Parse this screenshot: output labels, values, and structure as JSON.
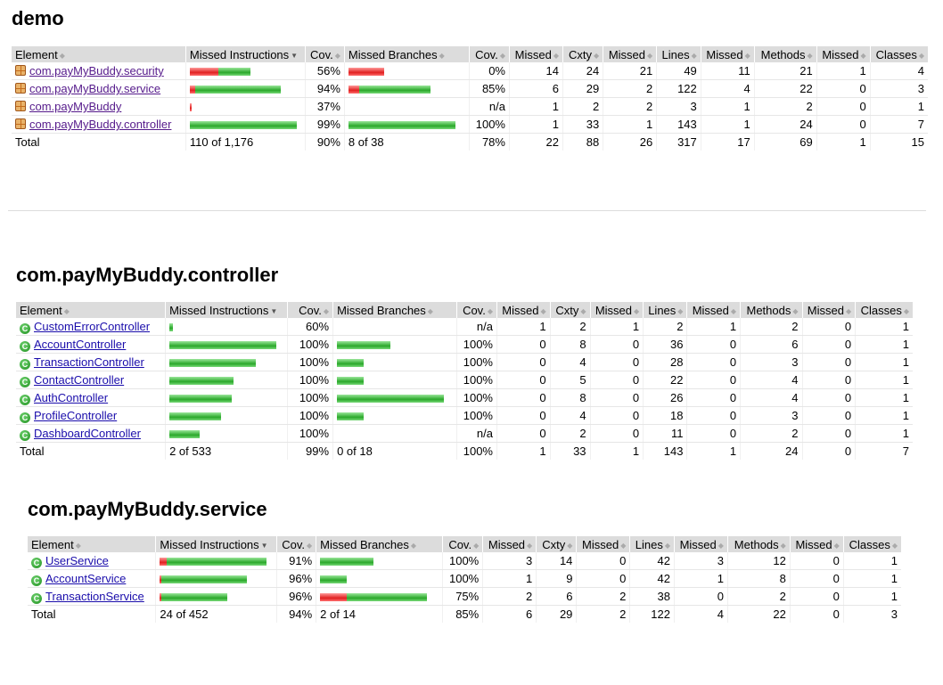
{
  "headers": {
    "element": "Element",
    "missed_instructions": "Missed Instructions",
    "cov": "Cov.",
    "missed_branches": "Missed Branches",
    "missed": "Missed",
    "cxty": "Cxty",
    "lines": "Lines",
    "methods": "Methods",
    "classes": "Classes",
    "total": "Total"
  },
  "sections": [
    {
      "title": "demo",
      "element_kind": "package",
      "rows": [
        {
          "name": "com.payMyBuddy.security",
          "instr": {
            "missed": 0.27,
            "covered": 0.3
          },
          "instr_cov": "56%",
          "br": {
            "missed": 0.33,
            "covered": 0.0
          },
          "br_cov": "0%",
          "mc": "14",
          "cx": "24",
          "ml": "21",
          "li": "49",
          "mm": "11",
          "me": "21",
          "mcl": "1",
          "cl": "4"
        },
        {
          "name": "com.payMyBuddy.service",
          "instr": {
            "missed": 0.05,
            "covered": 0.8
          },
          "instr_cov": "94%",
          "br": {
            "missed": 0.1,
            "covered": 0.67
          },
          "br_cov": "85%",
          "mc": "6",
          "cx": "29",
          "ml": "2",
          "li": "122",
          "mm": "4",
          "me": "22",
          "mcl": "0",
          "cl": "3"
        },
        {
          "name": "com.payMyBuddy",
          "instr": {
            "missed": 0.01,
            "covered": 0.0
          },
          "instr_cov": "37%",
          "br": null,
          "br_cov": "n/a",
          "mc": "1",
          "cx": "2",
          "ml": "2",
          "li": "3",
          "mm": "1",
          "me": "2",
          "mcl": "0",
          "cl": "1"
        },
        {
          "name": "com.payMyBuddy.controller",
          "instr": {
            "missed": 0.0,
            "covered": 1.0
          },
          "instr_cov": "99%",
          "br": {
            "missed": 0.0,
            "covered": 1.0
          },
          "br_cov": "100%",
          "mc": "1",
          "cx": "33",
          "ml": "1",
          "li": "143",
          "mm": "1",
          "me": "24",
          "mcl": "0",
          "cl": "7"
        }
      ],
      "total": {
        "instr": "110 of 1,176",
        "instr_cov": "90%",
        "br": "8 of 38",
        "br_cov": "78%",
        "mc": "22",
        "cx": "88",
        "ml": "26",
        "li": "317",
        "mm": "17",
        "me": "69",
        "mcl": "1",
        "cl": "15"
      }
    },
    {
      "title": "com.payMyBuddy.controller",
      "element_kind": "class",
      "rows": [
        {
          "name": "CustomErrorController",
          "instr": {
            "missed": 0.0,
            "covered": 0.03
          },
          "instr_cov": "60%",
          "br": null,
          "br_cov": "n/a",
          "mc": "1",
          "cx": "2",
          "ml": "1",
          "li": "2",
          "mm": "1",
          "me": "2",
          "mcl": "0",
          "cl": "1"
        },
        {
          "name": "AccountController",
          "instr": {
            "missed": 0.0,
            "covered": 1.0
          },
          "instr_cov": "100%",
          "br": {
            "missed": 0.0,
            "covered": 0.5
          },
          "br_cov": "100%",
          "mc": "0",
          "cx": "8",
          "ml": "0",
          "li": "36",
          "mm": "0",
          "me": "6",
          "mcl": "0",
          "cl": "1"
        },
        {
          "name": "TransactionController",
          "instr": {
            "missed": 0.0,
            "covered": 0.81
          },
          "instr_cov": "100%",
          "br": {
            "missed": 0.0,
            "covered": 0.25
          },
          "br_cov": "100%",
          "mc": "0",
          "cx": "4",
          "ml": "0",
          "li": "28",
          "mm": "0",
          "me": "3",
          "mcl": "0",
          "cl": "1"
        },
        {
          "name": "ContactController",
          "instr": {
            "missed": 0.0,
            "covered": 0.6
          },
          "instr_cov": "100%",
          "br": {
            "missed": 0.0,
            "covered": 0.25
          },
          "br_cov": "100%",
          "mc": "0",
          "cx": "5",
          "ml": "0",
          "li": "22",
          "mm": "0",
          "me": "4",
          "mcl": "0",
          "cl": "1"
        },
        {
          "name": "AuthController",
          "instr": {
            "missed": 0.0,
            "covered": 0.58
          },
          "instr_cov": "100%",
          "br": {
            "missed": 0.0,
            "covered": 1.0
          },
          "br_cov": "100%",
          "mc": "0",
          "cx": "8",
          "ml": "0",
          "li": "26",
          "mm": "0",
          "me": "4",
          "mcl": "0",
          "cl": "1"
        },
        {
          "name": "ProfileController",
          "instr": {
            "missed": 0.0,
            "covered": 0.48
          },
          "instr_cov": "100%",
          "br": {
            "missed": 0.0,
            "covered": 0.25
          },
          "br_cov": "100%",
          "mc": "0",
          "cx": "4",
          "ml": "0",
          "li": "18",
          "mm": "0",
          "me": "3",
          "mcl": "0",
          "cl": "1"
        },
        {
          "name": "DashboardController",
          "instr": {
            "missed": 0.0,
            "covered": 0.28
          },
          "instr_cov": "100%",
          "br": null,
          "br_cov": "n/a",
          "mc": "0",
          "cx": "2",
          "ml": "0",
          "li": "11",
          "mm": "0",
          "me": "2",
          "mcl": "0",
          "cl": "1"
        }
      ],
      "total": {
        "instr": "2 of 533",
        "instr_cov": "99%",
        "br": "0 of 18",
        "br_cov": "100%",
        "mc": "1",
        "cx": "33",
        "ml": "1",
        "li": "143",
        "mm": "1",
        "me": "24",
        "mcl": "0",
        "cl": "7"
      }
    },
    {
      "title": "com.payMyBuddy.service",
      "element_kind": "class",
      "rows": [
        {
          "name": "UserService",
          "instr": {
            "missed": 0.07,
            "covered": 0.93
          },
          "instr_cov": "91%",
          "br": {
            "missed": 0.0,
            "covered": 0.5
          },
          "br_cov": "100%",
          "mc": "3",
          "cx": "14",
          "ml": "0",
          "li": "42",
          "mm": "3",
          "me": "12",
          "mcl": "0",
          "cl": "1"
        },
        {
          "name": "AccountService",
          "instr": {
            "missed": 0.02,
            "covered": 0.8
          },
          "instr_cov": "96%",
          "br": {
            "missed": 0.0,
            "covered": 0.25
          },
          "br_cov": "100%",
          "mc": "1",
          "cx": "9",
          "ml": "0",
          "li": "42",
          "mm": "1",
          "me": "8",
          "mcl": "0",
          "cl": "1"
        },
        {
          "name": "TransactionService",
          "instr": {
            "missed": 0.02,
            "covered": 0.62
          },
          "instr_cov": "96%",
          "br": {
            "missed": 0.25,
            "covered": 0.75
          },
          "br_cov": "75%",
          "mc": "2",
          "cx": "6",
          "ml": "2",
          "li": "38",
          "mm": "0",
          "me": "2",
          "mcl": "0",
          "cl": "1"
        }
      ],
      "total": {
        "instr": "24 of 452",
        "instr_cov": "94%",
        "br": "2 of 14",
        "br_cov": "85%",
        "mc": "6",
        "cx": "29",
        "ml": "2",
        "li": "122",
        "mm": "4",
        "me": "22",
        "mcl": "0",
        "cl": "3"
      }
    }
  ]
}
